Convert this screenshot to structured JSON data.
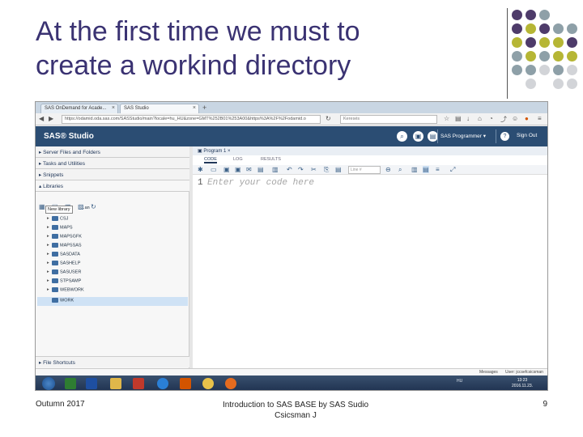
{
  "slide": {
    "title_line1": "At the first time we must to",
    "title_line2": "create a workind directory",
    "footer_left": "Outumn 2017",
    "footer_center_line1": "Introduction to SAS BASE by SAS Sudio",
    "footer_center_line2": "Csicsman J",
    "footer_right": "9",
    "dot_colors": {
      "purple": "#4e3b6a",
      "olive": "#b6b635",
      "slate": "#8ea0a8",
      "light": "#d2d4d8"
    }
  },
  "browser": {
    "tabs": [
      {
        "label": "SAS OnDemand for Acade...",
        "close": "×"
      },
      {
        "label": "SAS Studio",
        "close": "×"
      }
    ],
    "new_tab": "+",
    "url": "https://odamid.oda.sas.com/SASStudio/main?locale=hu_HU&zone=GMT%252B01%253A00&https%3A%2F%2Fodamid.o",
    "search_placeholder": "Keresés"
  },
  "app": {
    "name": "SAS® Studio",
    "program_menu": "SAS Programmer ▾",
    "sign_out": "Sign Out"
  },
  "navigation": {
    "sections": [
      "Server Files and Folders",
      "Tasks and Utilities",
      "Snippets",
      "Libraries"
    ],
    "tooltip": "New library",
    "libraries": [
      "CSJ",
      "MAPS",
      "MAPSGFK",
      "MAPSSAS",
      "SASDATA",
      "SASHELP",
      "SASUSER",
      "STPSAMP",
      "WEBWORK",
      "WORK"
    ],
    "my_libraries_label": "...an",
    "file_shortcuts": "File Shortcuts"
  },
  "editor": {
    "tab_title": "Program 1",
    "tabs": [
      "CODE",
      "LOG",
      "RESULTS"
    ],
    "line_placeholder": "Line #",
    "line_number": "1",
    "code_placeholder": "Enter your code here"
  },
  "status": {
    "messages": "Messages",
    "user": "User: jccsefcsicsman"
  },
  "taskbar": {
    "tray_lang": "HU",
    "time": "13:23",
    "date": "2016.11.23."
  }
}
